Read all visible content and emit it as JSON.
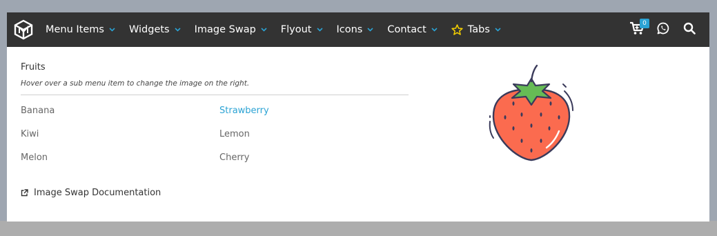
{
  "menu": {
    "items": [
      {
        "label": "Menu Items",
        "icon": "chevron-down-icon"
      },
      {
        "label": "Widgets",
        "icon": "chevron-down-icon"
      },
      {
        "label": "Image Swap",
        "icon": "chevron-down-icon"
      },
      {
        "label": "Flyout",
        "icon": "chevron-down-icon"
      },
      {
        "label": "Icons",
        "icon": "chevron-down-icon"
      },
      {
        "label": "Contact",
        "icon": "chevron-down-icon"
      },
      {
        "label": "Tabs",
        "icon": "chevron-down-icon",
        "leading_icon": "star-icon"
      }
    ],
    "cart_count": "0",
    "right_icons": [
      "cart-icon",
      "whatsapp-icon",
      "search-icon"
    ]
  },
  "dropdown": {
    "heading": "Fruits",
    "subheading": "Hover over a sub menu item to change the image on the right.",
    "col1": [
      "Banana",
      "Kiwi",
      "Melon"
    ],
    "col2": [
      "Strawberry",
      "Lemon",
      "Cherry"
    ],
    "active_item": "Strawberry",
    "doc_link": "Image Swap Documentation",
    "image": "strawberry-illustration"
  },
  "colors": {
    "menubar_bg": "#333333",
    "accent": "#2ba3d4",
    "star": "#f5d000",
    "strawberry_body": "#fb6b4f",
    "strawberry_leaf": "#66bb55",
    "outline": "#3a3a5a"
  }
}
